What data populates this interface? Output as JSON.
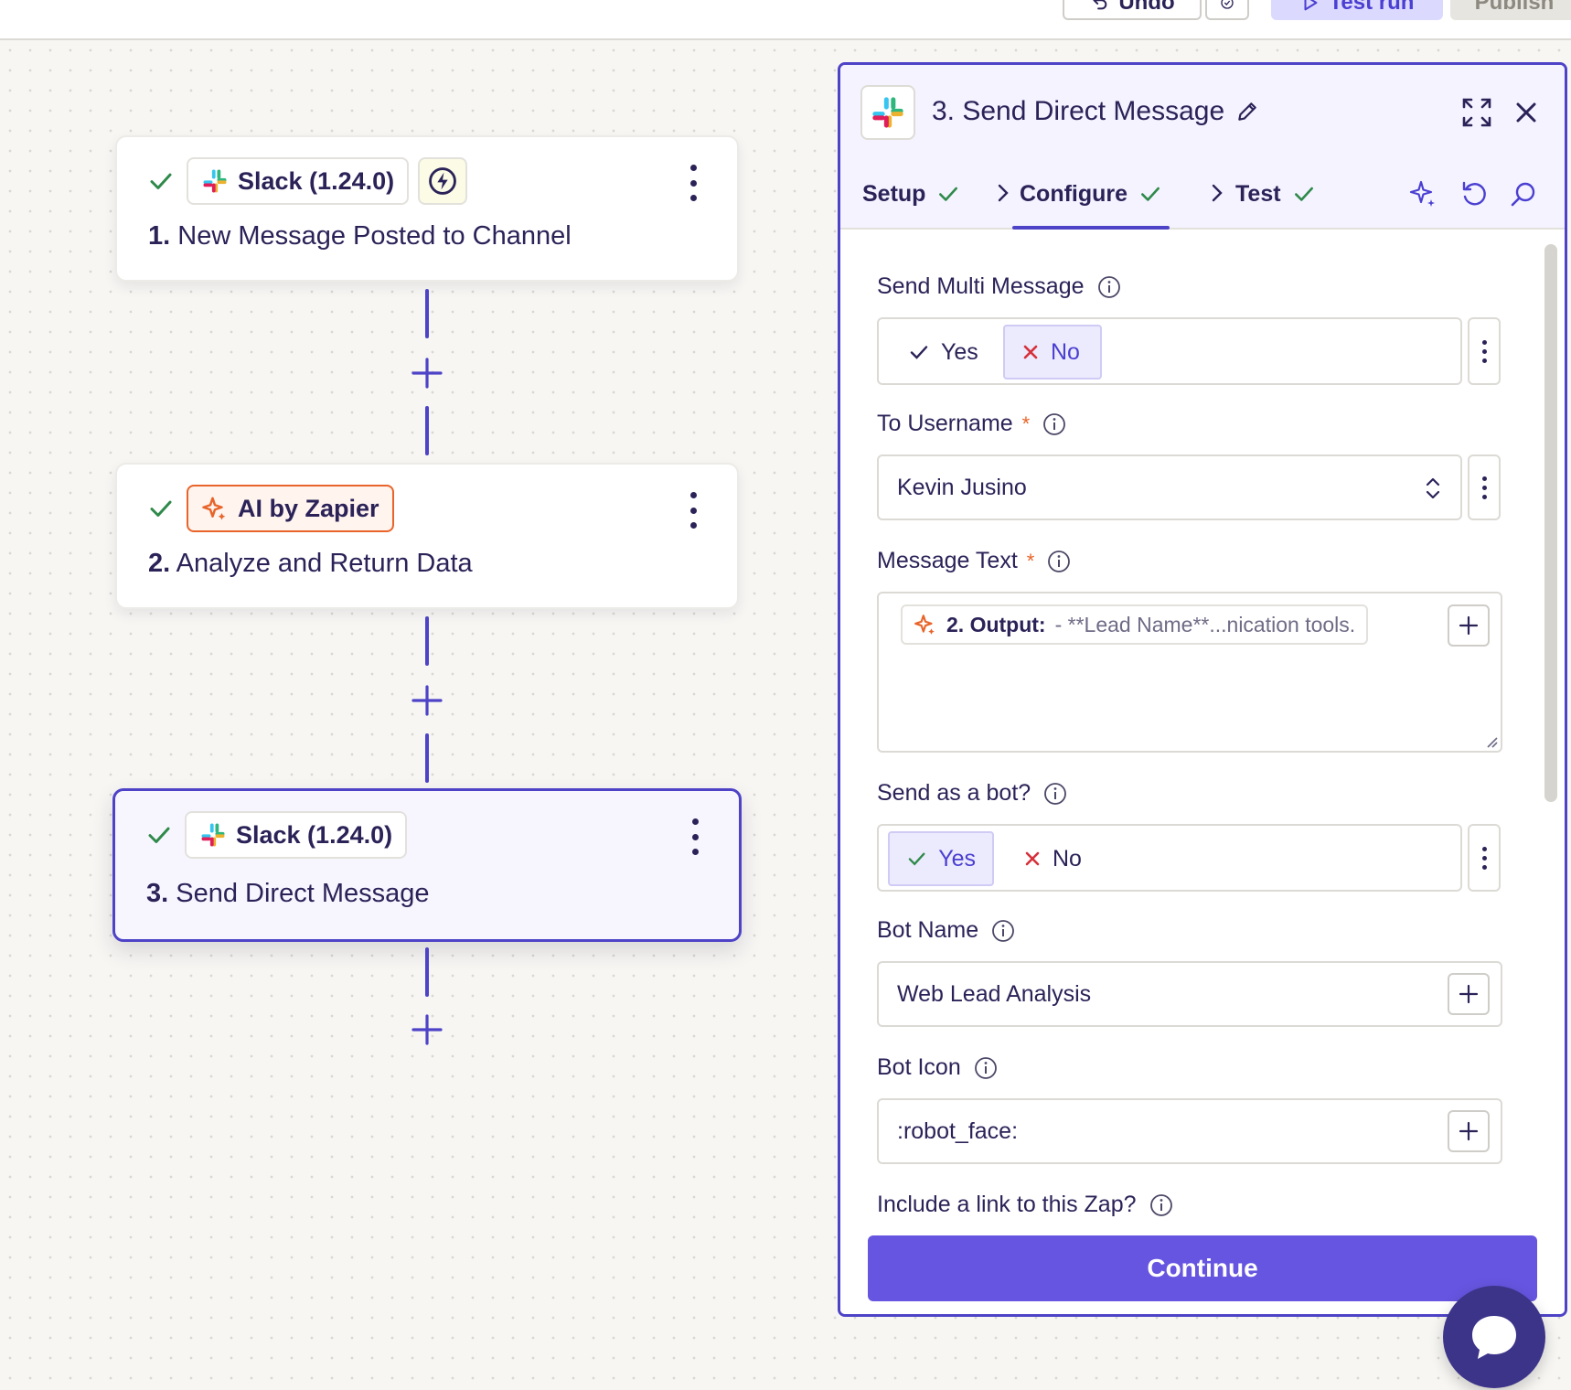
{
  "toolbar": {
    "undo_label": "Undo",
    "test_run_label": "Test run",
    "publish_label": "Publish"
  },
  "canvas": {
    "steps": [
      {
        "number": "1.",
        "title": "New Message Posted to Channel",
        "app": "Slack (1.24.0)",
        "icon": "slack-icon",
        "badge": "trigger-icon"
      },
      {
        "number": "2.",
        "title": "Analyze and Return Data",
        "app": "AI by Zapier",
        "icon": "sparkle-icon"
      },
      {
        "number": "3.",
        "title": "Send Direct Message",
        "app": "Slack (1.24.0)",
        "icon": "slack-icon",
        "selected": true
      }
    ]
  },
  "panel": {
    "title": "3. Send Direct Message",
    "tabs": [
      {
        "label": "Setup",
        "done": true
      },
      {
        "label": "Configure",
        "done": true,
        "active": true
      },
      {
        "label": "Test",
        "done": true
      }
    ],
    "fields": {
      "multi_message": {
        "label": "Send Multi Message",
        "yes": "Yes",
        "no": "No",
        "selected": "No"
      },
      "to_username": {
        "label": "To Username",
        "required": "*",
        "value": "Kevin Jusino"
      },
      "message_text": {
        "label": "Message Text",
        "required": "*",
        "pill_step": "2. Output:",
        "pill_text": "- **Lead Name**...nication tools."
      },
      "send_as_bot": {
        "label": "Send as a bot?",
        "yes": "Yes",
        "no": "No",
        "selected": "Yes"
      },
      "bot_name": {
        "label": "Bot Name",
        "value": "Web Lead Analysis"
      },
      "bot_icon": {
        "label": "Bot Icon",
        "value": ":robot_face:"
      },
      "include_link": {
        "label": "Include a link to this Zap?"
      }
    },
    "continue_label": "Continue"
  },
  "colors": {
    "accent": "#4e43c7",
    "button": "#6655e0",
    "success": "#2f8a4a",
    "ai_orange": "#e8642a",
    "danger": "#d6303a"
  }
}
